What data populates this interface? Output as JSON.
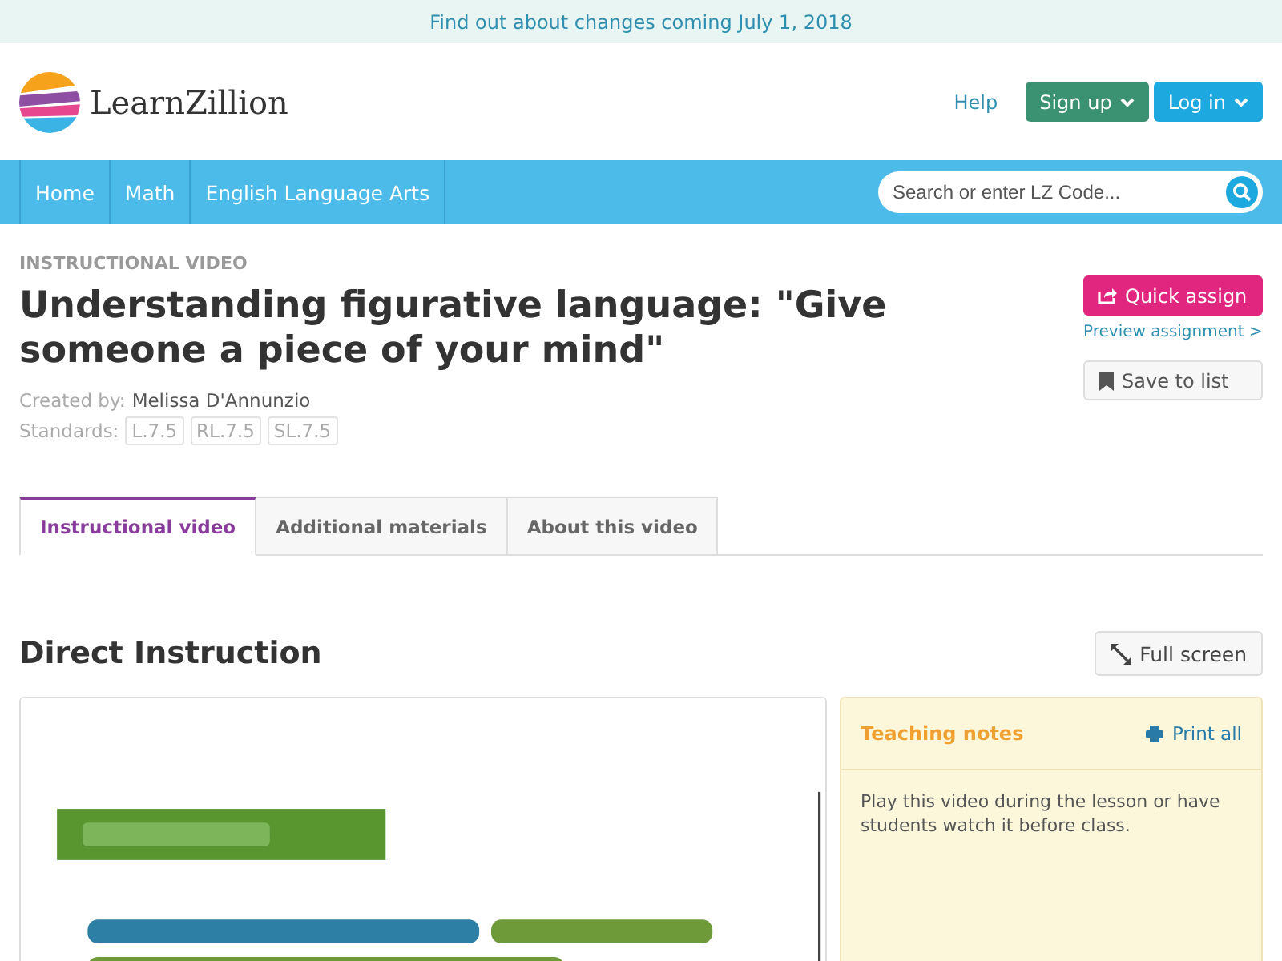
{
  "banner": {
    "text": "Find out about changes coming July 1, 2018"
  },
  "header": {
    "logo": "LearnZillion",
    "help": "Help",
    "signup": "Sign up",
    "login": "Log in"
  },
  "nav": {
    "items": [
      {
        "label": "Home"
      },
      {
        "label": "Math"
      },
      {
        "label": "English Language Arts"
      }
    ],
    "search": {
      "placeholder": "Search or enter LZ Code..."
    }
  },
  "lesson": {
    "eyebrow": "INSTRUCTIONAL VIDEO",
    "title": "Understanding figurative language: \"Give someone a piece of your mind\"",
    "created_label": "Created by:",
    "author": "Melissa D'Annunzio",
    "standards_label": "Standards:",
    "standards": [
      "L.7.5",
      "RL.7.5",
      "SL.7.5"
    ],
    "quick_assign": "Quick assign",
    "preview": "Preview assignment >",
    "save": "Save to list"
  },
  "tabs": [
    {
      "label": "Instructional video",
      "selected": true
    },
    {
      "label": "Additional materials",
      "selected": false
    },
    {
      "label": "About this video",
      "selected": false
    }
  ],
  "section": {
    "title": "Direct Instruction",
    "fullscreen": "Full screen"
  },
  "notes": {
    "title": "Teaching notes",
    "print": "Print all",
    "text": "Play this video during the lesson or have students watch it before class."
  }
}
